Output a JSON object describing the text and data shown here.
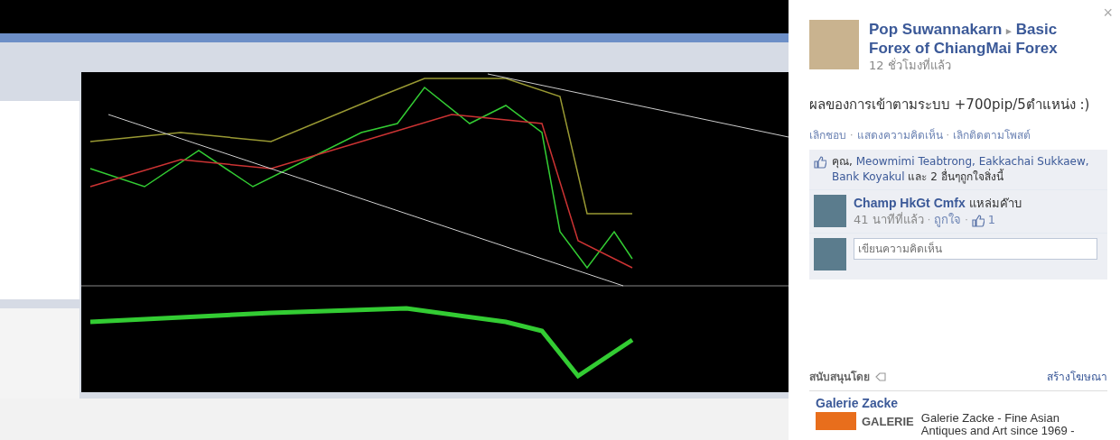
{
  "post": {
    "author": "Pop Suwannakarn",
    "separator": "▸",
    "target": "Basic Forex of ChiangMai Forex",
    "time": "12 ชั่วโมงที่แล้ว",
    "text": "ผลของการเข้าตามระบบ +700pip/5ตำแหน่ง :)",
    "actions": [
      {
        "label": "เลิกชอบ"
      },
      {
        "label": "แสดงความคิดเห็น"
      },
      {
        "label": "เลิกติดตามโพสต์"
      }
    ],
    "dot": "·",
    "likes": {
      "you": "คุณ,",
      "names": [
        {
          "label": "Meowmimi Teabtrong,"
        },
        {
          "label": "Eakkachai Sukkaew,"
        },
        {
          "label": "Bank Koyakul"
        }
      ],
      "rest": "และ 2 อื่นๆถูกใจสิ่งนี้"
    },
    "comments": [
      {
        "author": "Champ HkGt Cmfx",
        "text": "แหล่มค๊าบ",
        "time": "41 นาทีที่แล้ว",
        "like": "ถูกใจ",
        "like_count": "1"
      }
    ],
    "comment_field": {
      "placeholder": "เขียนความคิดเห็น"
    }
  },
  "sponsored": {
    "title": "สนับสนุนโดย",
    "create_ad": "สร้างโฆษณา",
    "ads": [
      {
        "name": "Galerie Zacke",
        "logo_text": "GALERIE",
        "text": "Galerie Zacke - Fine Asian Antiques and Art since 1969 -"
      }
    ]
  },
  "close": "×"
}
